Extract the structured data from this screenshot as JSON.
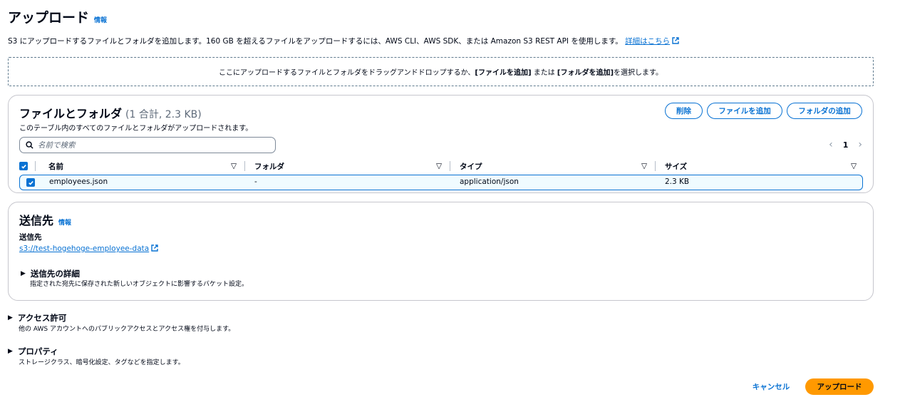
{
  "page": {
    "title": "アップロード",
    "info": "情報",
    "description": "S3 にアップロードするファイルとフォルダを追加します。160 GB を超えるファイルをアップロードするには、AWS CLI、AWS SDK、または Amazon S3 REST API を使用します。",
    "learn_more": "詳細はこちら"
  },
  "dropzone": {
    "text_a": "ここにアップロードするファイルとフォルダをドラッグアンドドロップするか、",
    "btn_files": "[ファイルを追加]",
    "text_b": " または ",
    "btn_folder": "[フォルダを追加]",
    "text_c": " を選択します。"
  },
  "files_panel": {
    "title": "ファイルとフォルダ",
    "count": "(1 合計, 2.3 KB)",
    "subtitle": "このテーブル内のすべてのファイルとフォルダがアップロードされます。",
    "delete": "削除",
    "add_files": "ファイルを追加",
    "add_folder": "フォルダの追加",
    "search_placeholder": "名前で検索",
    "page_number": "1",
    "columns": [
      "名前",
      "フォルダ",
      "タイプ",
      "サイズ"
    ],
    "rows": [
      {
        "name": "employees.json",
        "folder": "-",
        "type": "application/json",
        "size": "2.3 KB"
      }
    ]
  },
  "destination": {
    "title": "送信先",
    "info": "情報",
    "label": "送信先",
    "link": "s3://test-hogehoge-employee-data",
    "details_title": "送信先の詳細",
    "details_sub": "指定された宛先に保存された新しいオブジェクトに影響するバケット設定。"
  },
  "permissions": {
    "title": "アクセス許可",
    "sub": "他の AWS アカウントへのパブリックアクセスとアクセス権を付与します。"
  },
  "properties": {
    "title": "プロパティ",
    "sub": "ストレージクラス、暗号化設定、タグなどを指定します。"
  },
  "footer": {
    "cancel": "キャンセル",
    "upload": "アップロード"
  },
  "colors": {
    "accent": "#0972d3",
    "primary_button": "#ff9900"
  }
}
